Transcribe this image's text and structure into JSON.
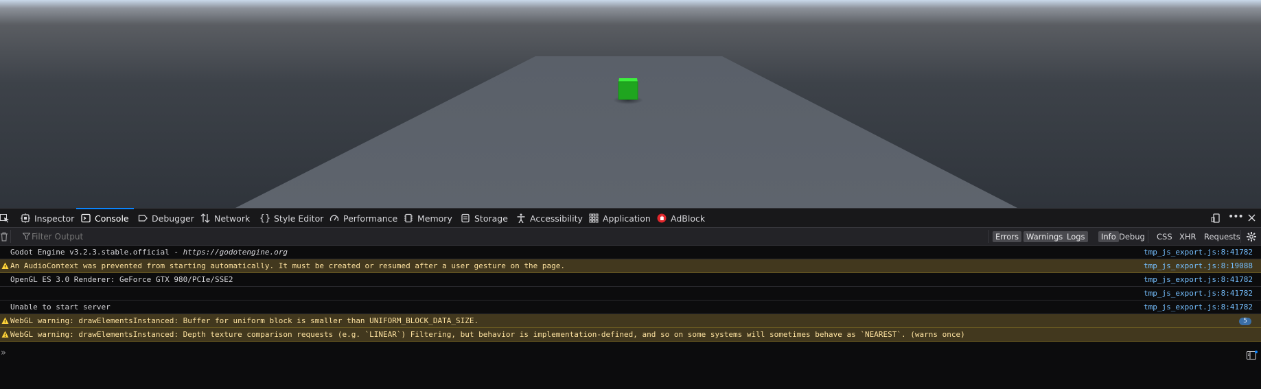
{
  "devtools": {
    "tabs": [
      {
        "label": "Inspector",
        "icon": "inspector-icon"
      },
      {
        "label": "Console",
        "icon": "console-icon"
      },
      {
        "label": "Debugger",
        "icon": "debugger-icon"
      },
      {
        "label": "Network",
        "icon": "network-icon"
      },
      {
        "label": "Style Editor",
        "icon": "style-editor-icon"
      },
      {
        "label": "Performance",
        "icon": "performance-icon"
      },
      {
        "label": "Memory",
        "icon": "memory-icon"
      },
      {
        "label": "Storage",
        "icon": "storage-icon"
      },
      {
        "label": "Accessibility",
        "icon": "accessibility-icon"
      },
      {
        "label": "Application",
        "icon": "application-icon"
      },
      {
        "label": "AdBlock",
        "icon": "adblock-icon"
      }
    ],
    "selected_tab": "Console",
    "filter_placeholder": "Filter Output",
    "filters": {
      "errors": "Errors",
      "warnings": "Warnings",
      "logs": "Logs",
      "info": "Info",
      "debug": "Debug",
      "css": "CSS",
      "xhr": "XHR",
      "requests": "Requests"
    },
    "messages": [
      {
        "text": "Godot Engine v3.2.3.stable.official - ",
        "link": "https://godotengine.org",
        "source": "tmp_js_export.js:8:41782",
        "level": "log"
      },
      {
        "text": "An AudioContext was prevented from starting automatically. It must be created or resumed after a user gesture on the page.",
        "source": "tmp_js_export.js:8:19088",
        "level": "warn"
      },
      {
        "text": "OpenGL ES 3.0 Renderer: GeForce GTX 980/PCIe/SSE2",
        "source": "tmp_js_export.js:8:41782",
        "level": "log"
      },
      {
        "text": "",
        "source": "tmp_js_export.js:8:41782",
        "level": "log"
      },
      {
        "text": "Unable to start server",
        "source": "tmp_js_export.js:8:41782",
        "level": "log"
      },
      {
        "text": "WebGL warning: drawElementsInstanced: Buffer for uniform block is smaller than UNIFORM_BLOCK_DATA_SIZE.",
        "source": "",
        "badge": "5",
        "level": "warn"
      },
      {
        "text": "WebGL warning: drawElementsInstanced: Depth texture comparison requests (e.g. `LINEAR`) Filtering, but behavior is implementation-defined, and so on some systems will sometimes behave as `NEAREST`. (warns once)",
        "source": "",
        "level": "warn"
      }
    ]
  },
  "colors": {
    "accent": "#0a84ff",
    "warn_bg": "#42381e",
    "link": "#75bfff",
    "cube": "#1fa51f"
  }
}
